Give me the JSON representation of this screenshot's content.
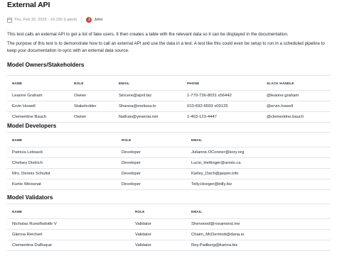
{
  "document": {
    "title": "External API",
    "meta": {
      "date": "Thu, Feb 20, 2025 - 10:15h (Latest)",
      "avatar_initial": "J",
      "author": "John"
    },
    "paragraphs": [
      "This test calls an external API to get a list of fake users. It then creates a table with the relevant data so it can be displayed in the documentation.",
      "The purpose of this test is to demonstrate how to call an external API and use the data in a test. A test like this could even be setup to run in a scheduled pipeline to keep your documentation in-sync with an external data source."
    ]
  },
  "owners": {
    "heading": "Model Owners/Stakeholders",
    "columns": [
      "NAME",
      "ROLE",
      "EMAIL",
      "PHONE",
      "SLACK HANDLE"
    ],
    "rows": [
      [
        "Leanne Graham",
        "Owner",
        "Sincere@april.biz",
        "1-770-736-8031 x56442",
        "@leanne.graham"
      ],
      [
        "Ervin Howell",
        "Stakeholder",
        "Shanna@melissa.tv",
        "010-692-6593 x09125",
        "@ervin.howell"
      ],
      [
        "Clementine Bauch",
        "Owner",
        "Nathan@yesenia.net",
        "1-463-123-4447",
        "@clementine.bauch"
      ]
    ]
  },
  "developers": {
    "heading": "Model Developers",
    "columns": [
      "NAME",
      "ROLE",
      "EMAIL"
    ],
    "rows": [
      [
        "Patricia Lebsack",
        "Developer",
        "Julianne.OConner@kory.org"
      ],
      [
        "Chelsey Dietrich",
        "Developer",
        "Lucio_Hettinger@annie.ca"
      ],
      [
        "Mrs. Dennis Schulist",
        "Developer",
        "Karley_Dach@jasper.info"
      ],
      [
        "Kurtis Weissnat",
        "Developer",
        "Telly.Hoeger@billy.biz"
      ]
    ]
  },
  "validators": {
    "heading": "Model Validators",
    "columns": [
      "NAME",
      "ROLE",
      "EMAIL"
    ],
    "rows": [
      [
        "Nicholas Runolfsdottir V",
        "Validator",
        "Sherwood@rosamond.me"
      ],
      [
        "Glenna Reichert",
        "Validator",
        "Chaim_McDermott@dana.io"
      ],
      [
        "Clementina DuBuque",
        "Validator",
        "Rey.Padberg@karina.biz"
      ]
    ]
  }
}
